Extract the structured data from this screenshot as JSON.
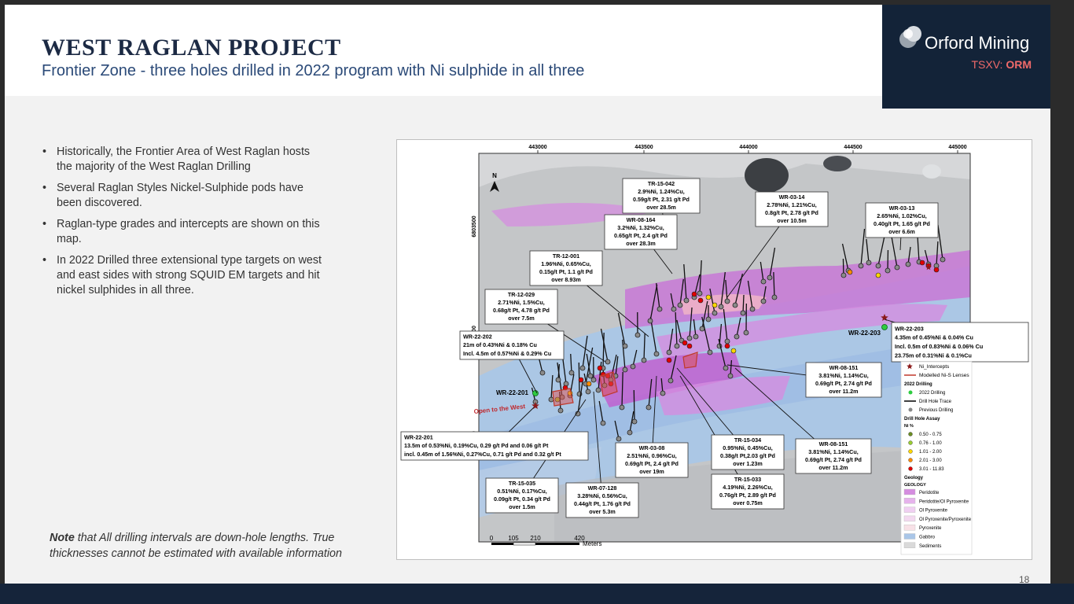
{
  "title": "WEST RAGLAN PROJECT",
  "subtitle": "Frontier Zone  - three holes drilled in 2022 program with Ni sulphide in all three",
  "logo": {
    "name": "Orford Mining",
    "ticker_label": "TSXV: ",
    "ticker": "ORM"
  },
  "bullets": [
    "Historically, the Frontier Area of West Raglan hosts the majority of the West Raglan Drilling",
    "Several Raglan Styles Nickel-Sulphide pods have been discovered.",
    "Raglan-type grades and intercepts are shown on this map.",
    "In 2022 Drilled three extensional type targets on west and east sides with strong SQUID EM targets and hit nickel sulphides in all three."
  ],
  "note": {
    "bold": "Note",
    "text": " that All drilling intervals are down-hole lengths. True thicknesses cannot be estimated with available information"
  },
  "page_number": "18",
  "map": {
    "x_ticks": [
      "443000",
      "443500",
      "444000",
      "444500",
      "445000"
    ],
    "y_ticks": [
      "6803500",
      "000",
      "000"
    ],
    "north": "N",
    "scale": {
      "ticks": [
        "0",
        "105",
        "210",
        "420"
      ],
      "unit": "Meters"
    },
    "open_to_west": "Open to the West",
    "hole_labels": [
      "WR-22-201",
      "WR-22-203"
    ],
    "callouts": [
      {
        "id": "tr15042",
        "lines": [
          "TR-15-042",
          "2.9%Ni, 1.24%Cu,",
          "0.59g/t Pt, 2.31 g/t Pd",
          "over 28.5m"
        ]
      },
      {
        "id": "wr08164",
        "lines": [
          "WR-08-164",
          "3.2%Ni, 1.32%Cu,",
          "0.65g/t Pt, 2.4 g/t Pd",
          "over 28.3m"
        ]
      },
      {
        "id": "wr0314",
        "lines": [
          "WR-03-14",
          "2.78%Ni, 1.21%Cu,",
          "0.8g/t Pt, 2.78 g/t Pd",
          "over 10.5m"
        ]
      },
      {
        "id": "wr0313",
        "lines": [
          "WR-03-13",
          "2.65%Ni, 1.02%Cu,",
          "0.40g/t Pt, 1.65 g/t Pd",
          "over 6.6m"
        ]
      },
      {
        "id": "tr12001",
        "lines": [
          "TR-12-001",
          "1.96%Ni, 0.65%Cu,",
          "0.15g/t Pt, 1.1 g/t Pd",
          "over 8.93m"
        ]
      },
      {
        "id": "tr12029",
        "lines": [
          "TR-12-029",
          "2.71%Ni, 1.5%Cu,",
          "0.68g/t Pt, 4.78 g/t Pd",
          "over 7.5m"
        ]
      },
      {
        "id": "wr22202",
        "lines": [
          "WR-22-202",
          "21m of 0.43%Ni & 0.18% Cu",
          "Incl. 4.5m of 0.57%Ni & 0.29% Cu"
        ]
      },
      {
        "id": "wr22203",
        "lines": [
          "WR-22-203",
          "4.35m of 0.45%Ni & 0.04% Cu",
          "Incl. 0.5m of 0.83%Ni & 0.06% Cu",
          "23.75m of 0.31%Ni & 0.1%Cu"
        ]
      },
      {
        "id": "wr08151a",
        "lines": [
          "WR-08-151",
          "3.81%Ni, 1.14%Cu,",
          "0.69g/t Pt, 2.74 g/t Pd",
          "over 11.2m"
        ]
      },
      {
        "id": "wr22201",
        "lines": [
          "WR-22-201",
          "13.5m of 0.53%Ni, 0.19%Cu, 0.29 g/t Pd and 0.06 g/t Pt",
          "incl. 0.45m of 1.56%Ni, 0.27%Cu, 0.71 g/t Pd and 0.32 g/t Pt"
        ]
      },
      {
        "id": "wr0308",
        "lines": [
          "WR-03-08",
          "2.51%Ni, 0.96%Cu,",
          "0.69g/t Pt, 2.4 g/t Pd",
          "over 19m"
        ]
      },
      {
        "id": "tr15034",
        "lines": [
          "TR-15-034",
          "0.95%Ni, 0.45%Cu,",
          "0.38g/t Pt,2.03 g/t Pd",
          "over 1.23m"
        ]
      },
      {
        "id": "wr08151b",
        "lines": [
          "WR-08-151",
          "3.81%Ni, 1.14%Cu,",
          "0.69g/t Pt, 2.74 g/t Pd",
          "over 11.2m"
        ]
      },
      {
        "id": "tr15035",
        "lines": [
          "TR-15-035",
          "0.51%Ni, 0.17%Cu,",
          "0.09g/t Pt, 0.34 g/t Pd",
          "over 1.5m"
        ]
      },
      {
        "id": "wr07128",
        "lines": [
          "WR-07-128",
          "3.28%Ni, 0.56%Cu,",
          "0.44g/t Pt, 1.76 g/t Pd",
          "over 5.3m"
        ]
      },
      {
        "id": "tr15033",
        "lines": [
          "TR-15-033",
          "4.19%Ni, 2.26%Cu,",
          "0.76g/t Pt, 2.89 g/t Pd",
          "over 0.75m"
        ]
      }
    ],
    "legend": {
      "items": [
        {
          "label": "Ni_Intercepts",
          "symbol": "star",
          "color": "#8b1a1a"
        },
        {
          "label": "Modelled Ni-S Lenses",
          "symbol": "line",
          "color": "#c0392b"
        }
      ],
      "drilling_title": "2022 Drilling",
      "drilling": [
        {
          "label": "2022 Drilling",
          "symbol": "dot",
          "color": "#2ecc40"
        },
        {
          "label": "Drill Hole Trace",
          "symbol": "line",
          "color": "#000000"
        },
        {
          "label": "Previous Drilling",
          "symbol": "dot",
          "color": "#888888"
        }
      ],
      "assay_title": "Drill Hole Assay",
      "assay_sub": "Ni %",
      "assay": [
        {
          "label": "0.50 - 0.75",
          "color": "#6b8e23"
        },
        {
          "label": "0.76 - 1.00",
          "color": "#9acd32"
        },
        {
          "label": "1.01 - 2.00",
          "color": "#ffd700"
        },
        {
          "label": "2.01 - 3.00",
          "color": "#ff8c00"
        },
        {
          "label": "3.01 - 11.83",
          "color": "#e00000"
        }
      ],
      "geology_title": "Geology",
      "geology_sub": "GEOLOGY",
      "geology": [
        {
          "label": "Peridotite",
          "color": "#d58de0"
        },
        {
          "label": "Peridotite/Ol Pyroxenite",
          "color": "#e6b3ec"
        },
        {
          "label": "Ol Pyroxenite",
          "color": "#f0d0f2"
        },
        {
          "label": "Ol Pyroxenite/Pyroxenite",
          "color": "#f3d9f0"
        },
        {
          "label": "Pyroxenite",
          "color": "#f8e1e7"
        },
        {
          "label": "Gabbro",
          "color": "#a9c6e8"
        },
        {
          "label": "Sediments",
          "color": "#d9d9d9"
        }
      ]
    }
  }
}
